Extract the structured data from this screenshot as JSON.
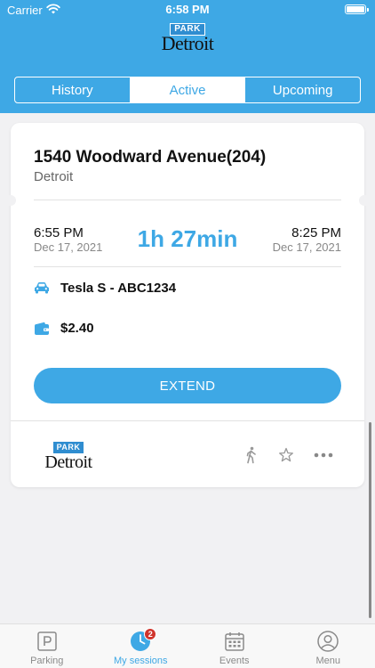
{
  "status_bar": {
    "carrier": "Carrier",
    "time": "6:58 PM"
  },
  "brand": {
    "park": "PARK",
    "city": "Detroit"
  },
  "tabs": [
    {
      "label": "History",
      "active": false
    },
    {
      "label": "Active",
      "active": true
    },
    {
      "label": "Upcoming",
      "active": false
    }
  ],
  "session": {
    "address": "1540 Woodward Avenue(204)",
    "city": "Detroit",
    "start_time": "6:55 PM",
    "start_date": "Dec 17, 2021",
    "duration": "1h 27min",
    "end_time": "8:25 PM",
    "end_date": "Dec 17, 2021",
    "vehicle": "Tesla S - ABC1234",
    "amount": "$2.40",
    "extend_label": "EXTEND"
  },
  "footer_icons": [
    "walking-person-icon",
    "star-icon",
    "more-icon"
  ],
  "tabbar": [
    {
      "label": "Parking",
      "icon": "parking-icon",
      "active": false
    },
    {
      "label": "My sessions",
      "icon": "clock-icon",
      "active": true,
      "badge": "2"
    },
    {
      "label": "Events",
      "icon": "calendar-icon",
      "active": false
    },
    {
      "label": "Menu",
      "icon": "user-icon",
      "active": false
    }
  ],
  "colors": {
    "accent": "#3ea8e5",
    "badge": "#d0342c",
    "background": "#f1f1f3"
  }
}
